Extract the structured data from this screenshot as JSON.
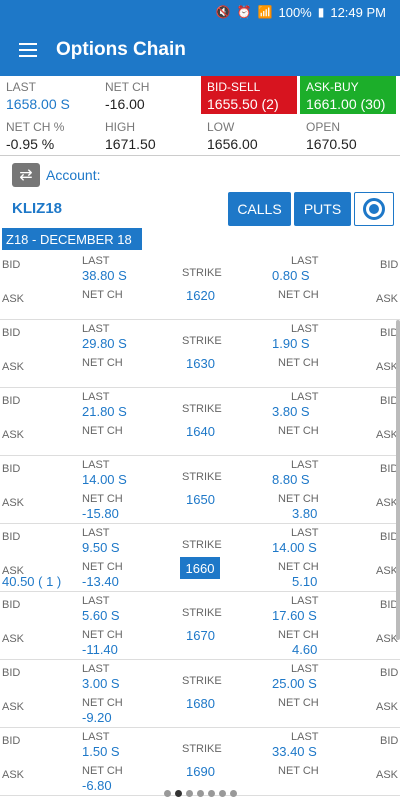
{
  "status": {
    "battery_pct": "100%",
    "time": "12:49 PM"
  },
  "app": {
    "title": "Options Chain"
  },
  "quote": {
    "last_label": "LAST",
    "last": "1658.00 S",
    "netch_label": "NET CH",
    "netch": "-16.00",
    "bidsell_label": "BID-SELL",
    "bidsell": "1655.50 (2)",
    "askbuy_label": "ASK-BUY",
    "askbuy": "1661.00 (30)",
    "netchpct_label": "NET CH %",
    "netchpct": "-0.95 %",
    "high_label": "HIGH",
    "high": "1671.50",
    "low_label": "LOW",
    "low": "1656.00",
    "open_label": "OPEN",
    "open": "1670.50"
  },
  "account": {
    "label": "Account:",
    "symbol": "KLIZ18"
  },
  "buttons": {
    "calls": "CALLS",
    "puts": "PUTS"
  },
  "expiry": "Z18 - DECEMBER 18",
  "labels": {
    "bid": "BID",
    "ask": "ASK",
    "last": "LAST",
    "netch": "NET CH",
    "strike": "STRIKE"
  },
  "rows": [
    {
      "strike": "1620",
      "call_last": "38.80 S",
      "call_netch": "",
      "call_ask": "",
      "put_last": "0.80 S",
      "put_netch": ""
    },
    {
      "strike": "1630",
      "call_last": "29.80 S",
      "call_netch": "",
      "call_ask": "",
      "put_last": "1.90 S",
      "put_netch": ""
    },
    {
      "strike": "1640",
      "call_last": "21.80 S",
      "call_netch": "",
      "call_ask": "",
      "put_last": "3.80 S",
      "put_netch": ""
    },
    {
      "strike": "1650",
      "call_last": "14.00 S",
      "call_netch": "-15.80",
      "call_ask": "",
      "put_last": "8.80 S",
      "put_netch": "3.80"
    },
    {
      "strike": "1660",
      "call_last": "9.50 S",
      "call_netch": "-13.40",
      "call_ask": "40.50 ( 1 )",
      "put_last": "14.00 S",
      "put_netch": "5.10",
      "highlight": true
    },
    {
      "strike": "1670",
      "call_last": "5.60 S",
      "call_netch": "-11.40",
      "call_ask": "",
      "put_last": "17.60 S",
      "put_netch": "4.60"
    },
    {
      "strike": "1680",
      "call_last": "3.00 S",
      "call_netch": "-9.20",
      "call_ask": "",
      "put_last": "25.00 S",
      "put_netch": ""
    },
    {
      "strike": "1690",
      "call_last": "1.50 S",
      "call_netch": "-6.80",
      "call_ask": "",
      "put_last": "33.40 S",
      "put_netch": ""
    }
  ],
  "colors": {
    "primary": "#1e78c8",
    "bid": "#d7141f",
    "ask": "#1cae2a"
  }
}
